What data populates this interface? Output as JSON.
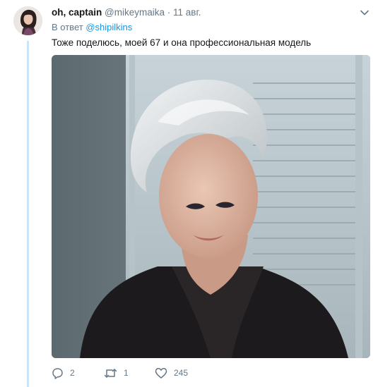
{
  "tweet": {
    "display_name": "oh, captain",
    "handle": "@mikeymaika",
    "separator": "·",
    "date": "11 авг.",
    "reply_prefix": "В ответ",
    "reply_handle": "@shipilkins",
    "text": "Тоже поделюсь, моей 67 и она профессиональная модель"
  },
  "actions": {
    "reply_count": "2",
    "retweet_count": "1",
    "like_count": "245"
  },
  "icons": {
    "caret": "chevron-down-icon",
    "reply": "reply-icon",
    "retweet": "retweet-icon",
    "like": "heart-icon"
  },
  "colors": {
    "link": "#1b95e0",
    "muted": "#657786",
    "thread_line": "#cce4f7"
  }
}
